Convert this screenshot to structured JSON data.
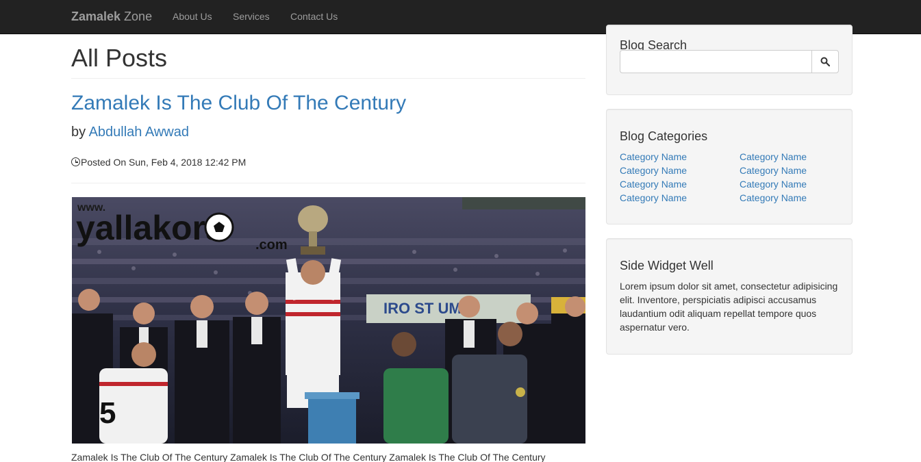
{
  "navbar": {
    "brand_bold": "Zamalek",
    "brand_rest": " Zone",
    "links": [
      {
        "label": "About Us"
      },
      {
        "label": "Services"
      },
      {
        "label": "Contact Us"
      }
    ]
  },
  "main": {
    "page_title": "All Posts",
    "post": {
      "title": "Zamalek Is The Club Of The Century",
      "author_prefix": "by ",
      "author": "Abdullah Awwad",
      "posted_on": "Posted On Sun, Feb 4, 2018 12:42 PM",
      "image_watermark": {
        "site": "yallakora",
        "tld": ".com",
        "prefix": "www."
      },
      "image_banner_text": "IRO ST UM",
      "excerpt": "Zamalek Is The Club Of The Century Zamalek Is The Club Of The Century Zamalek Is The Club Of The Century"
    }
  },
  "sidebar": {
    "search": {
      "title": "Blog Search",
      "placeholder": "",
      "value": "",
      "icon": "search-icon"
    },
    "categories": {
      "title": "Blog Categories",
      "left": [
        "Category Name",
        "Category Name",
        "Category Name",
        "Category Name"
      ],
      "right": [
        "Category Name",
        "Category Name",
        "Category Name",
        "Category Name"
      ]
    },
    "widget": {
      "title": "Side Widget Well",
      "text": "Lorem ipsum dolor sit amet, consectetur adipisicing elit. Inventore, perspiciatis adipisci accusamus laudantium odit aliquam repellat tempore quos aspernatur vero."
    }
  },
  "colors": {
    "navbar_bg": "#222222",
    "nav_text": "#9d9d9d",
    "link": "#337ab7",
    "well_bg": "#f5f5f5"
  }
}
